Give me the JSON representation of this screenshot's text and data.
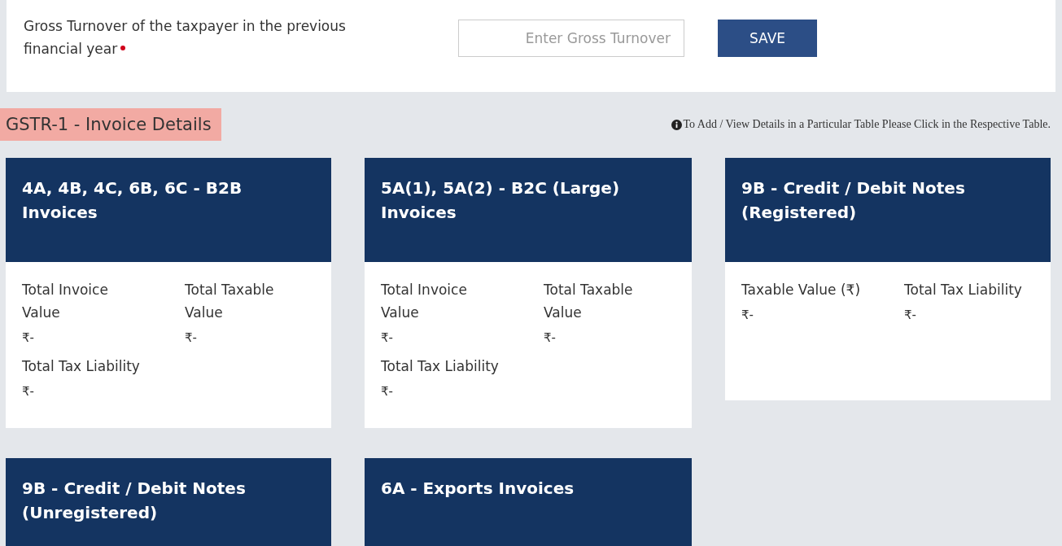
{
  "turnover": {
    "label": "Gross Turnover of the taxpayer in the previous financial year",
    "required": true,
    "placeholder": "Enter Gross Turnover",
    "button": "SAVE"
  },
  "section": {
    "title": "GSTR-1 - Invoice Details",
    "note": "To Add / View Details in a Particular Table Please Click in the Respective Table."
  },
  "cards": [
    {
      "title": "4A, 4B, 4C, 6B, 6C - B2B Invoices",
      "fields": [
        {
          "label": "Total Invoice Value",
          "value": "₹-"
        },
        {
          "label": "Total Taxable Value",
          "value": "₹-"
        },
        {
          "label": "Total Tax Liability",
          "value": "₹-"
        }
      ]
    },
    {
      "title": "5A(1), 5A(2) - B2C (Large) Invoices",
      "fields": [
        {
          "label": "Total Invoice Value",
          "value": "₹-"
        },
        {
          "label": "Total Taxable Value",
          "value": "₹-"
        },
        {
          "label": "Total Tax Liability",
          "value": "₹-"
        }
      ]
    },
    {
      "title": "9B - Credit / Debit Notes (Registered)",
      "fields": [
        {
          "label": "Taxable Value (₹)",
          "value": "₹-"
        },
        {
          "label": "Total Tax Liability",
          "value": "₹-"
        }
      ]
    },
    {
      "title": "9B - Credit / Debit Notes (Unregistered)"
    },
    {
      "title": "6A - Exports Invoices"
    }
  ]
}
